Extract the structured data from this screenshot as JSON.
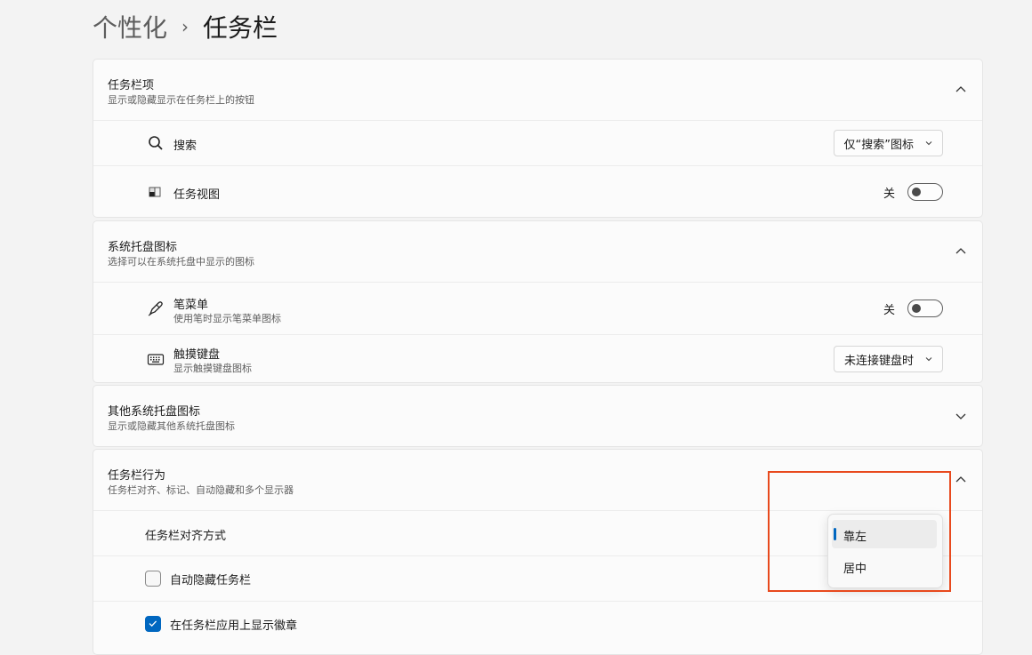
{
  "breadcrumb": {
    "parent": "个性化",
    "current": "任务栏"
  },
  "taskbar_items": {
    "title": "任务栏项",
    "description": "显示或隐藏显示在任务栏上的按钮",
    "search": {
      "label": "搜索",
      "value": "仅“搜索”图标"
    },
    "task_view": {
      "label": "任务视图",
      "state": "关"
    }
  },
  "tray_icons": {
    "title": "系统托盘图标",
    "description": "选择可以在系统托盘中显示的图标",
    "pen_menu": {
      "label": "笔菜单",
      "description": "使用笔时显示笔菜单图标",
      "state": "关"
    },
    "touch_keyboard": {
      "label": "触摸键盘",
      "description": "显示触摸键盘图标",
      "value": "未连接键盘时"
    }
  },
  "other_tray": {
    "title": "其他系统托盘图标",
    "description": "显示或隐藏其他系统托盘图标"
  },
  "behaviors": {
    "title": "任务栏行为",
    "description": "任务栏对齐、标记、自动隐藏和多个显示器",
    "alignment": {
      "label": "任务栏对齐方式"
    },
    "auto_hide": {
      "label": "自动隐藏任务栏",
      "checked": false
    },
    "badges": {
      "label": "在任务栏应用上显示徽章",
      "checked": true
    }
  },
  "alignment_popup": {
    "options": [
      "靠左",
      "居中"
    ],
    "selected": "靠左"
  },
  "colors": {
    "accent": "#0067c0",
    "highlight": "#e8491d"
  }
}
